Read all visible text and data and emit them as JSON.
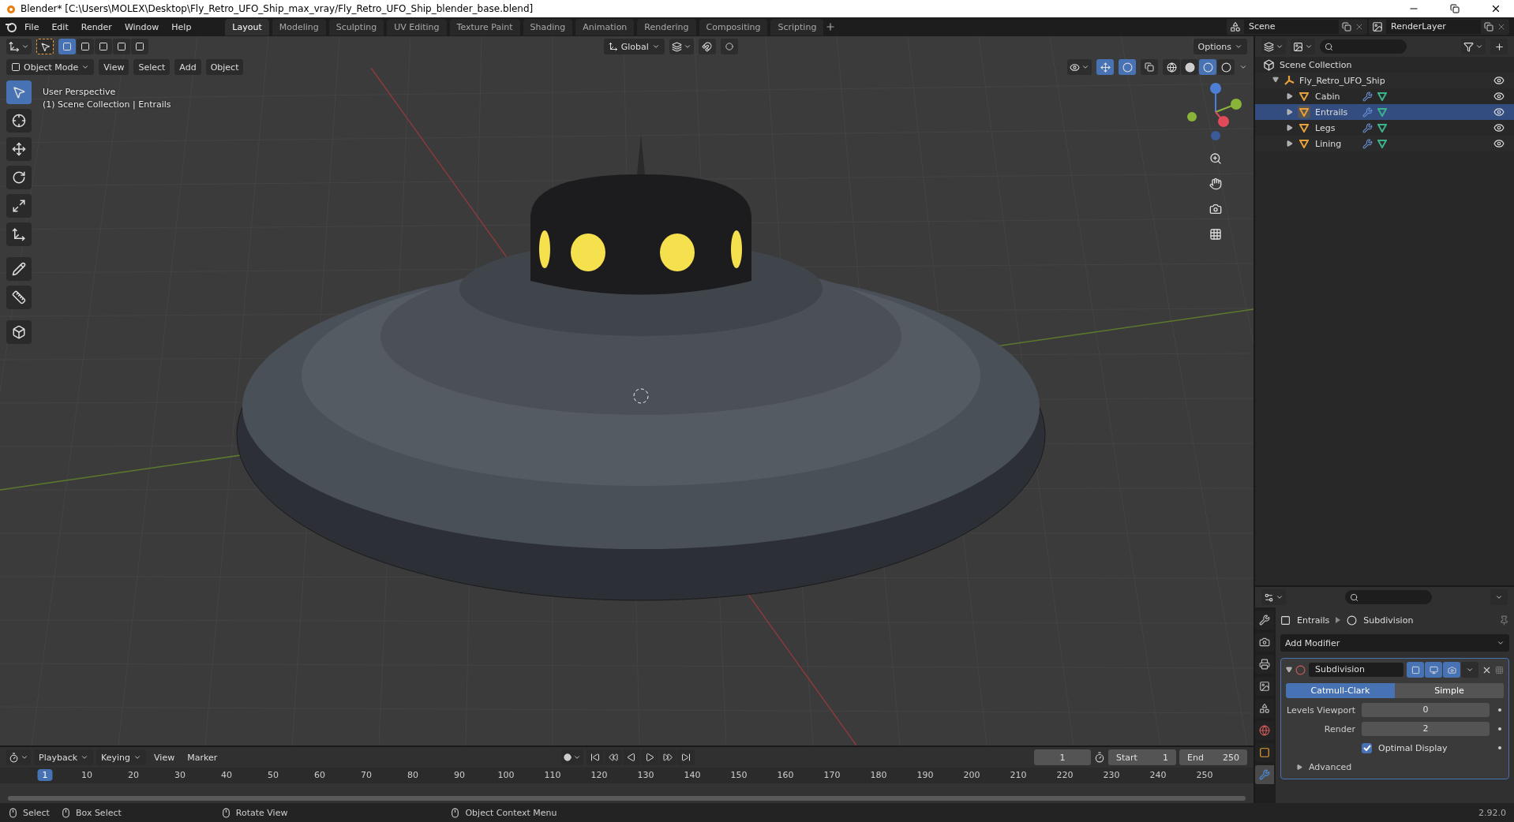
{
  "window": {
    "title": "Blender* [C:\\Users\\MOLEX\\Desktop\\Fly_Retro_UFO_Ship_max_vray/Fly_Retro_UFO_Ship_blender_base.blend]"
  },
  "menu": [
    "File",
    "Edit",
    "Render",
    "Window",
    "Help"
  ],
  "workspaces": [
    {
      "label": "Layout",
      "selected": true
    },
    {
      "label": "Modeling",
      "selected": false
    },
    {
      "label": "Sculpting",
      "selected": false
    },
    {
      "label": "UV Editing",
      "selected": false
    },
    {
      "label": "Texture Paint",
      "selected": false
    },
    {
      "label": "Shading",
      "selected": false
    },
    {
      "label": "Animation",
      "selected": false
    },
    {
      "label": "Rendering",
      "selected": false
    },
    {
      "label": "Compositing",
      "selected": false
    },
    {
      "label": "Scripting",
      "selected": false
    }
  ],
  "scene": "Scene",
  "render_layer": "RenderLayer",
  "viewport": {
    "select_modes": [
      {
        "selected": true
      },
      {
        "selected": false
      },
      {
        "selected": false
      },
      {
        "selected": false
      },
      {
        "selected": false
      }
    ],
    "orientation": "Global",
    "options": "Options",
    "mode": "Object Mode",
    "menus": [
      "View",
      "Select",
      "Add",
      "Object"
    ],
    "shading": [
      {
        "kind": "wireframe",
        "selected": false
      },
      {
        "kind": "solid",
        "selected": false
      },
      {
        "kind": "material",
        "selected": true
      },
      {
        "kind": "rendered",
        "selected": false
      }
    ],
    "info": [
      "User Perspective",
      "(1) Scene Collection | Entrails"
    ],
    "tools": [
      {
        "kind": "select",
        "selected": true
      },
      {
        "kind": "cursor",
        "selected": false
      },
      {
        "kind": "move",
        "selected": false
      },
      {
        "kind": "rotate",
        "selected": false
      },
      {
        "kind": "scale",
        "selected": false
      },
      {
        "kind": "transform",
        "selected": false
      },
      {
        "kind": "annotate",
        "selected": false
      },
      {
        "kind": "measure",
        "selected": false
      },
      {
        "kind": "add-cube",
        "selected": false
      }
    ]
  },
  "outliner": {
    "root": "Scene Collection",
    "tree": [
      {
        "label": "Fly_Retro_UFO_Ship",
        "expanded": true,
        "selected": false,
        "children": [
          {
            "label": "Cabin",
            "expanded": false,
            "selected": false
          },
          {
            "label": "Entrails",
            "expanded": false,
            "selected": true
          },
          {
            "label": "Legs",
            "expanded": false,
            "selected": false
          },
          {
            "label": "Lining",
            "expanded": false,
            "selected": false
          }
        ]
      }
    ]
  },
  "properties": {
    "tabs": [
      {
        "kind": "tool",
        "selected": false
      },
      {
        "kind": "render",
        "selected": false
      },
      {
        "kind": "output",
        "selected": false
      },
      {
        "kind": "view-layer",
        "selected": false
      },
      {
        "kind": "scene",
        "selected": false
      },
      {
        "kind": "world",
        "selected": false
      },
      {
        "kind": "object",
        "selected": false
      },
      {
        "kind": "modifier",
        "selected": true
      }
    ],
    "breadcrumb": [
      "Entrails",
      "Subdivision"
    ],
    "add_modifier": "Add Modifier",
    "modifier": {
      "name": "Subdivision",
      "expanded": true,
      "modes": [
        {
          "label": "Catmull-Clark",
          "selected": true
        },
        {
          "label": "Simple",
          "selected": false
        }
      ],
      "fields": [
        {
          "label": "Levels Viewport",
          "value": "0"
        },
        {
          "label": "Render",
          "value": "2"
        }
      ],
      "optimal_display": {
        "label": "Optimal Display",
        "checked": true
      },
      "advanced": {
        "label": "Advanced",
        "expanded": false
      }
    }
  },
  "timeline": {
    "menus": [
      "Playback",
      "Keying",
      "View",
      "Marker"
    ],
    "current_frame": "1",
    "start_label": "Start",
    "start": "1",
    "end_label": "End",
    "end": "250",
    "marker": "1",
    "ruler": [
      "10",
      "20",
      "30",
      "40",
      "50",
      "60",
      "70",
      "80",
      "90",
      "100",
      "110",
      "120",
      "130",
      "140",
      "150",
      "160",
      "170",
      "180",
      "190",
      "200",
      "210",
      "220",
      "230",
      "240",
      "250"
    ]
  },
  "status_bar": {
    "hints": [
      "Select",
      "Box Select",
      "Rotate View",
      "Object Context Menu"
    ],
    "version": "2.92.0"
  }
}
